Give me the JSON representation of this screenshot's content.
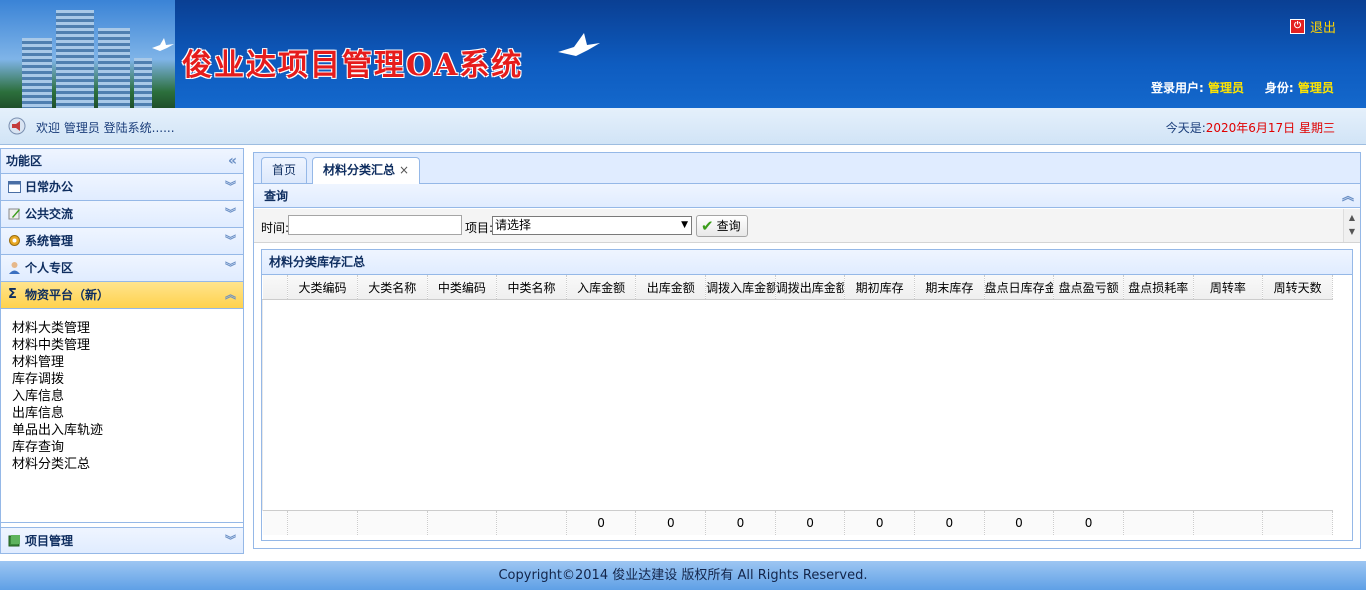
{
  "header": {
    "system_title": "俊业达项目管理OA系统",
    "logout_label": "退出",
    "user_label": "登录用户:",
    "user_value": "管理员",
    "role_label": "身份:",
    "role_value": "管理员"
  },
  "welcome": {
    "message": "欢迎 管理员 登陆系统......",
    "today_label": "今天是:",
    "today_value": "2020年6月17日 星期三"
  },
  "sidebar": {
    "title": "功能区",
    "sections": [
      {
        "label": "日常办公",
        "icon": "calendar-icon"
      },
      {
        "label": "公共交流",
        "icon": "pencil-icon"
      },
      {
        "label": "系统管理",
        "icon": "gear-icon"
      },
      {
        "label": "个人专区",
        "icon": "person-icon"
      },
      {
        "label": "物资平台（新）",
        "icon": "sigma-icon"
      }
    ],
    "items": [
      "材料大类管理",
      "材料中类管理",
      "材料管理",
      "库存调拨",
      "入库信息",
      "出库信息",
      "单品出入库轨迹",
      "库存查询",
      "材料分类汇总"
    ],
    "bottom_section": {
      "label": "项目管理",
      "icon": "book-icon"
    }
  },
  "tabs": [
    {
      "label": "首页"
    },
    {
      "label": "材料分类汇总",
      "close": "×"
    }
  ],
  "query": {
    "title": "查询",
    "time_label": "时间:",
    "time_value": "",
    "project_label": "项目:",
    "project_value": "请选择",
    "button_label": "查询"
  },
  "grid": {
    "title": "材料分类库存汇总",
    "columns": [
      "大类编码",
      "大类名称",
      "中类编码",
      "中类名称",
      "入库金额",
      "出库金额",
      "调拨入库金额",
      "调拨出库金额",
      "期初库存",
      "期末库存",
      "盘点日库存金额",
      "盘点盈亏额",
      "盘点损耗率",
      "周转率",
      "周转天数"
    ],
    "footer": [
      "",
      "",
      "",
      "",
      "0",
      "0",
      "0",
      "0",
      "0",
      "0",
      "0",
      "0",
      "",
      "",
      ""
    ]
  },
  "footer": {
    "copyright": "Copyright©2014 俊业达建设 版权所有 All Rights Reserved."
  },
  "colors": {
    "header_blue": "#0e5cc0",
    "title_red": "#e61c1c",
    "highlight_yellow": "#ffe400",
    "active_section": "#ffd24d",
    "date_red": "#e00000"
  }
}
